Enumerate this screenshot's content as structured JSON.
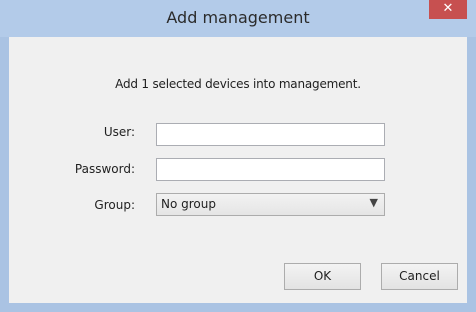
{
  "dialog": {
    "title": "Add management",
    "close_label": "✕",
    "message": "Add 1 selected devices into management."
  },
  "form": {
    "user_label": "User:",
    "user_value": "",
    "password_label": "Password:",
    "password_value": "",
    "group_label": "Group:",
    "group_selected": "No group"
  },
  "buttons": {
    "ok_label": "OK",
    "cancel_label": "Cancel"
  },
  "icons": {
    "close": "close-icon",
    "dropdown": "chevron-down-icon"
  },
  "colors": {
    "titlebar": "#b3cbe9",
    "close_button": "#c75050",
    "client_area": "#f0f0f0"
  }
}
